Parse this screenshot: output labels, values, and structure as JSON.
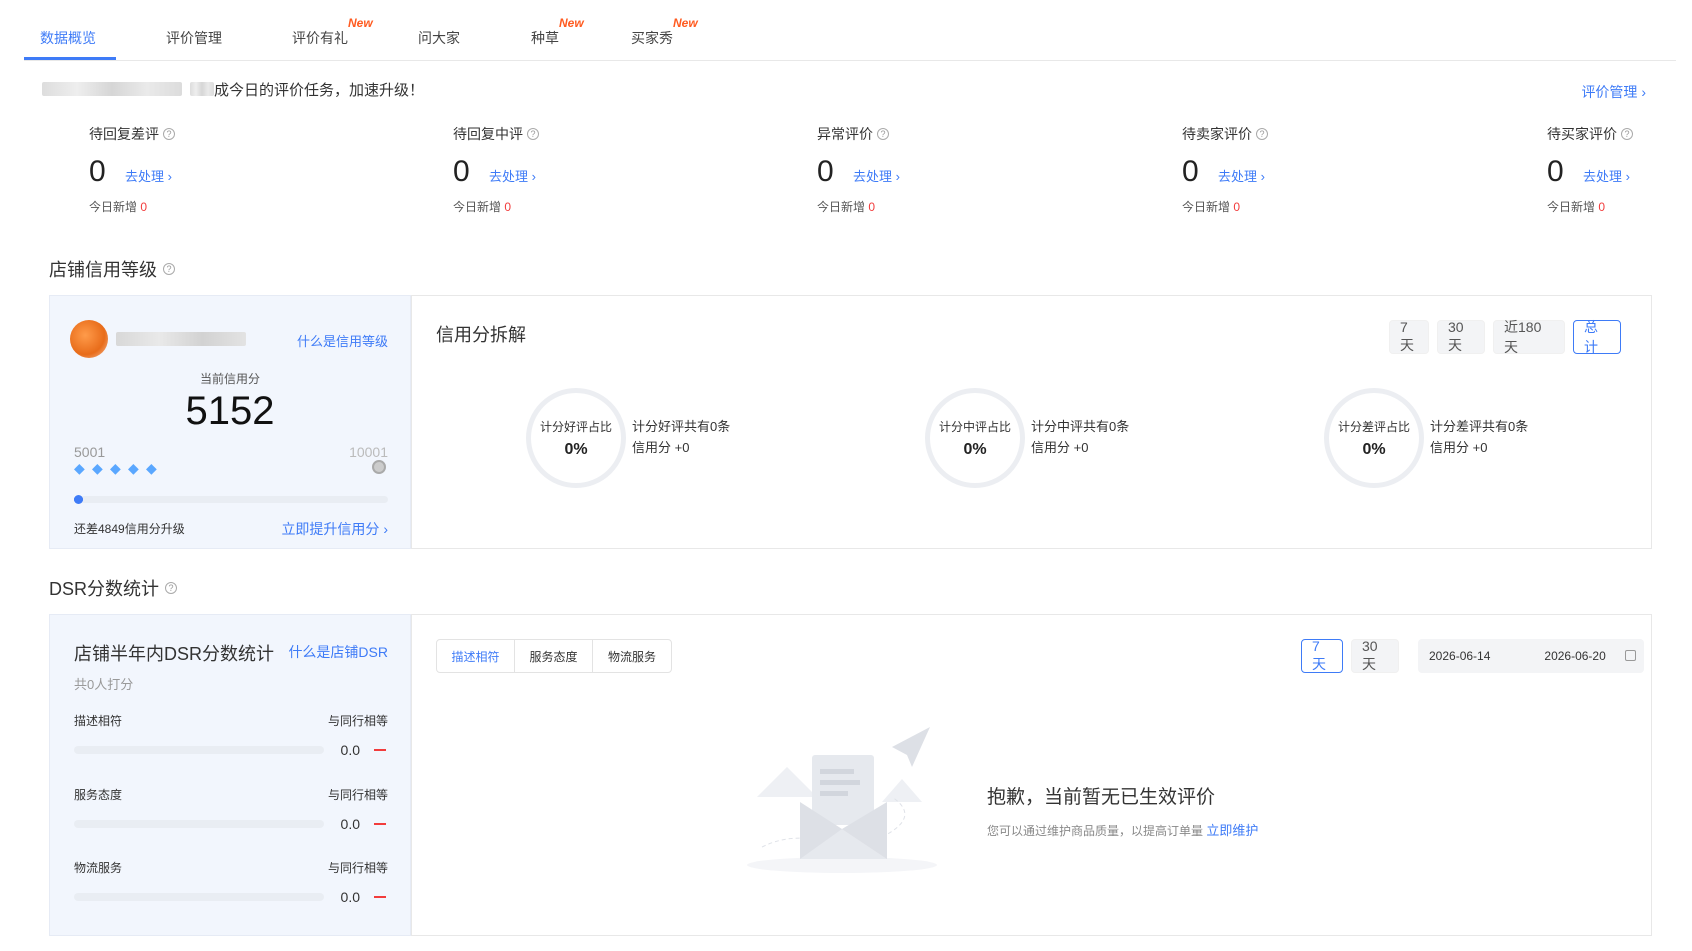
{
  "tabs": [
    {
      "label": "数据概览",
      "active": true,
      "badge": ""
    },
    {
      "label": "评价管理",
      "active": false,
      "badge": ""
    },
    {
      "label": "评价有礼",
      "active": false,
      "badge": "New"
    },
    {
      "label": "问大家",
      "active": false,
      "badge": ""
    },
    {
      "label": "种草",
      "active": false,
      "badge": "New"
    },
    {
      "label": "买家秀",
      "active": false,
      "badge": "New"
    }
  ],
  "notice": {
    "text": "成今日的评价任务，加速升级！",
    "link": "评价管理 ›"
  },
  "stats": [
    {
      "title": "待回复差评",
      "value": "0",
      "link": "去处理 ›",
      "today_label": "今日新增",
      "today_value": "0"
    },
    {
      "title": "待回复中评",
      "value": "0",
      "link": "去处理 ›",
      "today_label": "今日新增",
      "today_value": "0"
    },
    {
      "title": "异常评价",
      "value": "0",
      "link": "去处理 ›",
      "today_label": "今日新增",
      "today_value": "0"
    },
    {
      "title": "待卖家评价",
      "value": "0",
      "link": "去处理 ›",
      "today_label": "今日新增",
      "today_value": "0"
    },
    {
      "title": "待买家评价",
      "value": "0",
      "link": "去处理 ›",
      "today_label": "今日新增",
      "today_value": "0"
    }
  ],
  "credit_section": {
    "title": "店铺信用等级"
  },
  "credit_card": {
    "link": "什么是信用等级",
    "score_label": "当前信用分",
    "score": "5152",
    "range_min": "5001",
    "range_max": "10001",
    "diamond_count": 5,
    "progress": 0.03,
    "gap_text": "还差4849信用分升级",
    "boost_link": "立即提升信用分 ›"
  },
  "credit_breakdown": {
    "title": "信用分拆解",
    "periods": [
      {
        "label": "7天",
        "active": false
      },
      {
        "label": "30天",
        "active": false
      },
      {
        "label": "近180天",
        "active": false
      },
      {
        "label": "总计",
        "active": true
      }
    ],
    "rings": [
      {
        "label": "计分好评占比",
        "value": "0%",
        "line1": "计分好评共有0条",
        "line2": "信用分 +0"
      },
      {
        "label": "计分中评占比",
        "value": "0%",
        "line1": "计分中评共有0条",
        "line2": "信用分 +0"
      },
      {
        "label": "计分差评占比",
        "value": "0%",
        "line1": "计分差评共有0条",
        "line2": "信用分 +0"
      }
    ]
  },
  "dsr_section": {
    "title": "DSR分数统计"
  },
  "dsr_card": {
    "title": "店铺半年内DSR分数统计",
    "link": "什么是店铺DSR",
    "count": "共0人打分",
    "rows": [
      {
        "label": "描述相符",
        "compare": "与同行相等",
        "value": "0.0"
      },
      {
        "label": "服务态度",
        "compare": "与同行相等",
        "value": "0.0"
      },
      {
        "label": "物流服务",
        "compare": "与同行相等",
        "value": "0.0"
      }
    ]
  },
  "dsr_detail": {
    "tabs": [
      {
        "label": "描述相符",
        "active": true
      },
      {
        "label": "服务态度",
        "active": false
      },
      {
        "label": "物流服务",
        "active": false
      }
    ],
    "periods": [
      {
        "label": "7天",
        "active": true
      },
      {
        "label": "30天",
        "active": false
      }
    ],
    "date_start": "2026-06-14",
    "date_end": "2026-06-20",
    "empty_title": "抱歉，当前暂无已生效评价",
    "empty_sub": "您可以通过维护商品质量，以提高订单量",
    "empty_link": "立即维护"
  },
  "colors": {
    "accent": "#3e7bf7",
    "danger": "#f23c3c",
    "badge": "#ff5a1f"
  }
}
